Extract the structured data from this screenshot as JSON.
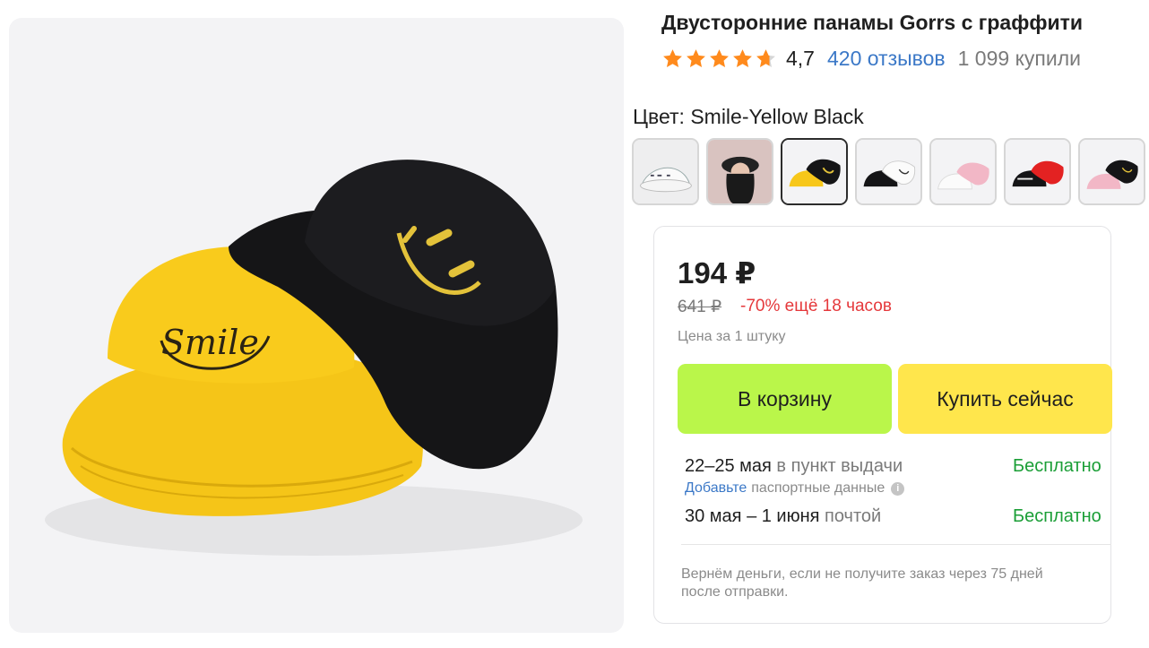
{
  "product": {
    "title": "Двусторонние панамы Gorrs с граффити",
    "rating": "4,7",
    "reviews": "420 отзывов",
    "bought": "1 099 купили",
    "stars_value": 4.7
  },
  "color": {
    "label": "Цвет: Smile-Yellow Black",
    "swatches": [
      {
        "name": "white-graffiti"
      },
      {
        "name": "model-photo"
      },
      {
        "name": "yellow-black",
        "selected": true
      },
      {
        "name": "black-white"
      },
      {
        "name": "white-pink"
      },
      {
        "name": "black-red"
      },
      {
        "name": "pink-black"
      }
    ]
  },
  "offer": {
    "price": "194 ₽",
    "old_price": "641 ₽",
    "discount": "-70% ещё 18 часов",
    "unit_note": "Цена за 1 штуку",
    "cart_button": "В корзину",
    "buy_button": "Купить сейчас"
  },
  "delivery": {
    "pickup_date": "22–25 мая",
    "pickup_method": " в пункт выдачи",
    "pickup_price": "Бесплатно",
    "passport_link": "Добавьте",
    "passport_rest": " паспортные данные",
    "post_date": "30 мая – 1 июня",
    "post_method": " почтой",
    "post_price": "Бесплатно"
  },
  "guarantee": "Вернём деньги, если не получите заказ через 75 дней после отправки.",
  "colors": {
    "cart": "#baf64a",
    "buy": "#ffe64c",
    "discount": "#e5383b",
    "free": "#1a9e36",
    "link": "#3b78c7",
    "star": "#ff8a1c"
  }
}
